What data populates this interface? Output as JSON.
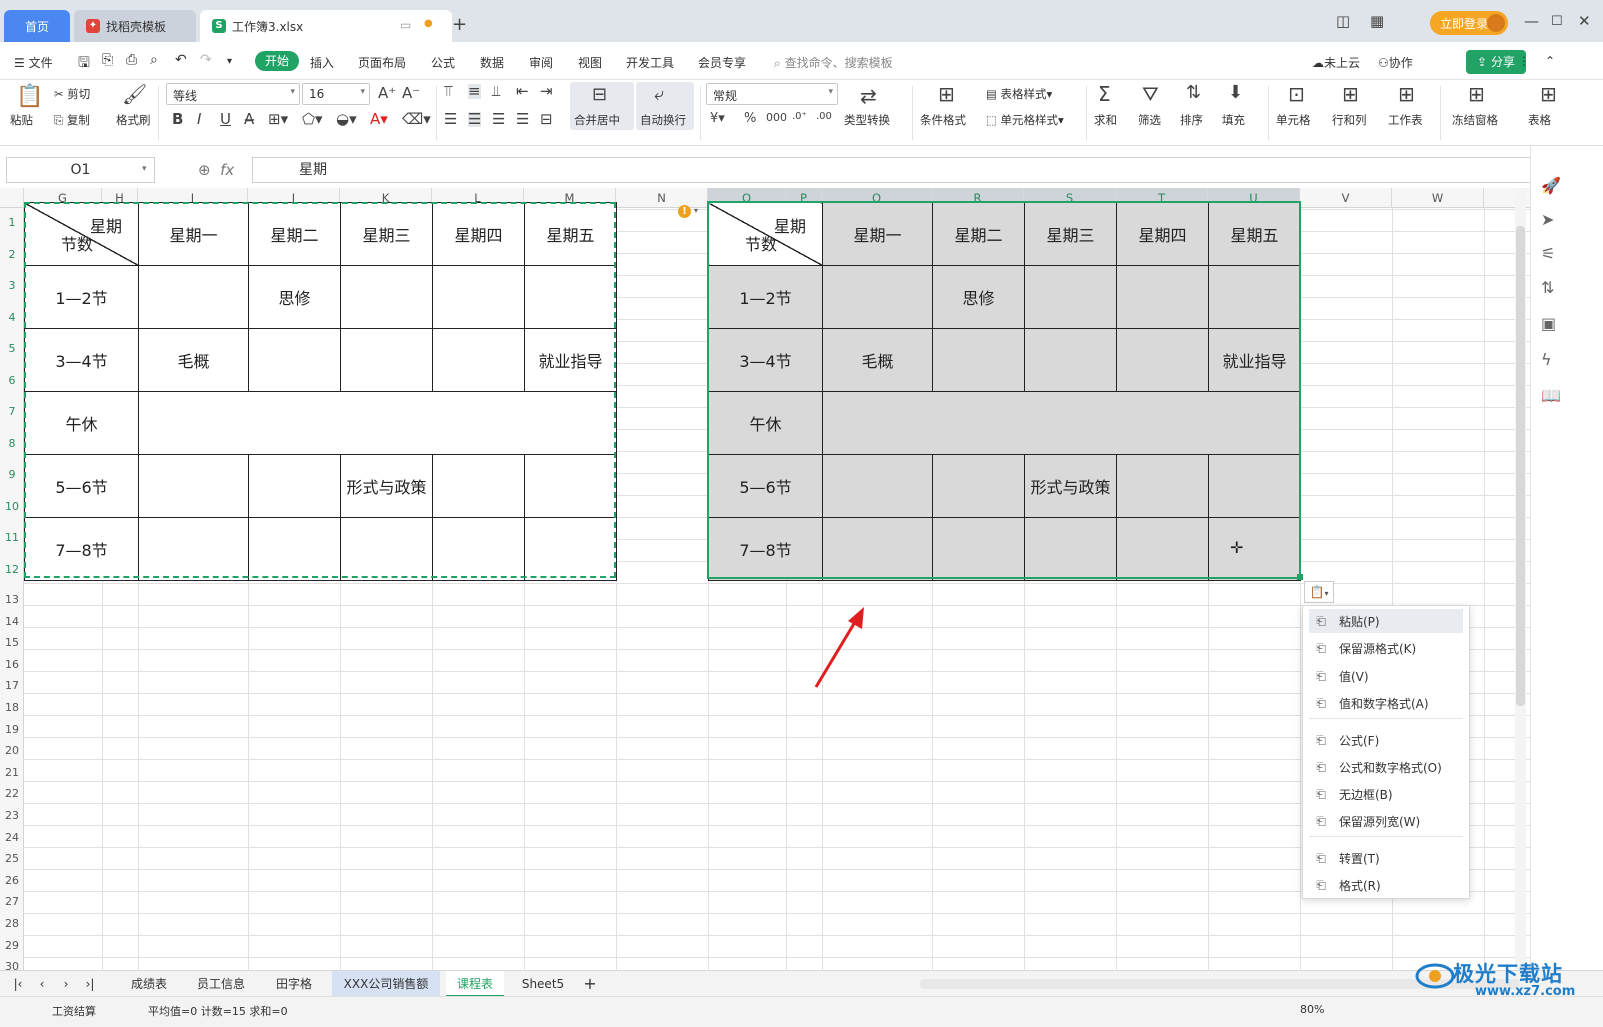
{
  "tabs": {
    "home": "首页",
    "template": "找稻壳模板",
    "file": "工作簿3.xlsx"
  },
  "topbar": {
    "login": "立即登录"
  },
  "menu": {
    "file": "文件",
    "items": [
      "开始",
      "插入",
      "页面布局",
      "公式",
      "数据",
      "审阅",
      "视图",
      "开发工具",
      "会员专享"
    ],
    "search": "查找命令、搜索模板",
    "cloud": "未上云",
    "collab": "协作",
    "share": "分享"
  },
  "ribbon": {
    "paste": "粘贴",
    "cut": "剪切",
    "copy": "复制",
    "format_painter": "格式刷",
    "font": "等线",
    "size": "16",
    "bold": "B",
    "italic": "I",
    "underline": "U",
    "merge": "合并居中",
    "wrap": "自动换行",
    "numfmt": "常规",
    "convert": "类型转换",
    "cond": "条件格式",
    "table_style": "表格样式",
    "cell_style": "单元格样式",
    "sum": "求和",
    "filter": "筛选",
    "sort": "排序",
    "fill": "填充",
    "cell": "单元格",
    "rowcol": "行和列",
    "sheet": "工作表",
    "freeze": "冻结窗格",
    "table_tools": "表格"
  },
  "formula_bar": {
    "cell": "O1",
    "fx": "fx",
    "value": "星期"
  },
  "columns_left": [
    "G",
    "H",
    "I",
    "J",
    "K",
    "L",
    "M",
    "N"
  ],
  "columns_right": [
    "O",
    "P",
    "Q",
    "R",
    "S",
    "T",
    "U",
    "V",
    "W"
  ],
  "rows": [
    "1",
    "2",
    "3",
    "4",
    "5",
    "6",
    "7",
    "8",
    "9",
    "10",
    "11",
    "12",
    "13",
    "14",
    "15",
    "16",
    "17",
    "18",
    "19",
    "20",
    "21",
    "22",
    "23",
    "24",
    "25",
    "26",
    "27",
    "28",
    "29",
    "30"
  ],
  "schedule": {
    "header_top": "星期",
    "header_bottom": "节数",
    "days": [
      "星期一",
      "星期二",
      "星期三",
      "星期四",
      "星期五"
    ],
    "rows": [
      {
        "label": "1—2节",
        "cells": [
          "",
          "思修",
          "",
          "",
          ""
        ]
      },
      {
        "label": "3—4节",
        "cells": [
          "毛概",
          "",
          "",
          "",
          "就业指导"
        ]
      },
      {
        "label": "5—6节",
        "cells": [
          "",
          "",
          "形式与政策",
          "",
          ""
        ]
      },
      {
        "label": "7—8节",
        "cells": [
          "",
          "",
          "",
          "",
          ""
        ]
      }
    ],
    "lunch": "午休"
  },
  "paste_menu": [
    {
      "icon": "paste-icon",
      "label": "粘贴(P)"
    },
    {
      "icon": "keep-format-icon",
      "label": "保留源格式(K)"
    },
    {
      "icon": "values-icon",
      "label": "值(V)"
    },
    {
      "icon": "values-number-icon",
      "label": "值和数字格式(A)"
    },
    {
      "icon": "formula-icon",
      "label": "公式(F)"
    },
    {
      "icon": "formula-number-icon",
      "label": "公式和数字格式(O)"
    },
    {
      "icon": "no-border-icon",
      "label": "无边框(B)"
    },
    {
      "icon": "keep-width-icon",
      "label": "保留源列宽(W)"
    },
    {
      "icon": "transpose-icon",
      "label": "转置(T)"
    },
    {
      "icon": "format-icon",
      "label": "格式(R)"
    }
  ],
  "sheets": [
    "成绩表",
    "员工信息",
    "田字格",
    "XXX公司销售额",
    "课程表",
    "Sheet5"
  ],
  "status": {
    "left": "工资结算",
    "stats": "平均值=0 计数=15 求和=0",
    "zoom": "80%"
  },
  "watermark": {
    "text": "极光下载站",
    "url": "www.xz7.com"
  },
  "colors": {
    "accent": "#21a366",
    "selection_fill": "#d9d9d9",
    "tab_blue": "#4b87f0"
  }
}
